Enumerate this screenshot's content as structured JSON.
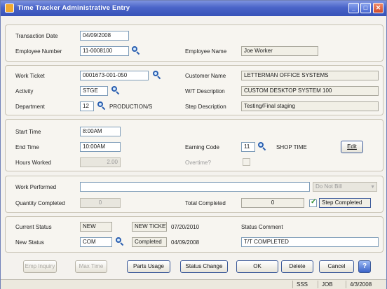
{
  "window": {
    "title": "Time Tracker Administrative Entry",
    "minimize": "_",
    "maximize": "□",
    "close": "✕"
  },
  "header": {
    "transaction_date_label": "Transaction Date",
    "transaction_date": "04/09/2008",
    "employee_number_label": "Employee Number",
    "employee_number": "11-0008100",
    "employee_name_label": "Employee Name",
    "employee_name": "Joe Worker"
  },
  "ticket": {
    "work_ticket_label": "Work Ticket",
    "work_ticket": "0001673-001-050",
    "customer_name_label": "Customer Name",
    "customer_name": "LETTERMAN OFFICE SYSTEMS",
    "activity_label": "Activity",
    "activity": "STGE",
    "wt_description_label": "W/T Description",
    "wt_description": "CUSTOM DESKTOP SYSTEM 100",
    "department_label": "Department",
    "department": "12",
    "department_name": "PRODUCTION/S",
    "step_description_label": "Step Description",
    "step_description": "Testing/Final staging"
  },
  "time": {
    "start_time_label": "Start Time",
    "start_time": "8:00AM",
    "end_time_label": "End Time",
    "end_time": "10:00AM",
    "hours_worked_label": "Hours Worked",
    "hours_worked": "2.00",
    "earning_code_label": "Earning Code",
    "earning_code": "11",
    "earning_code_name": "SHOP TIME",
    "overtime_label": "Overtime?",
    "edit_label": "Edit"
  },
  "work": {
    "work_performed_label": "Work Performed",
    "work_performed": "",
    "billing_option": "Do Not Bill",
    "quantity_completed_label": "Quantity Completed",
    "quantity_completed": "0",
    "total_completed_label": "Total Completed",
    "total_completed": "0",
    "step_completed_label": "Step Completed",
    "step_completed_checked": true
  },
  "status": {
    "current_status_label": "Current Status",
    "current_status": "NEW",
    "current_status_desc": "NEW TICKET",
    "current_status_date": "07/20/2010",
    "status_comment_label": "Status Comment",
    "new_status_label": "New Status",
    "new_status": "COM",
    "new_status_desc": "Completed",
    "new_status_date": "04/09/2008",
    "status_comment": "T/T COMPLETED"
  },
  "buttons": {
    "emp_inquiry": "Emp Inquiry",
    "max_time": "Max Time",
    "parts_usage": "Parts Usage",
    "status_change": "Status Change",
    "ok": "OK",
    "delete": "Delete",
    "cancel": "Cancel",
    "help": "?"
  },
  "statusbar": {
    "company": "SSS",
    "module": "JOB",
    "date": "4/3/2008"
  }
}
